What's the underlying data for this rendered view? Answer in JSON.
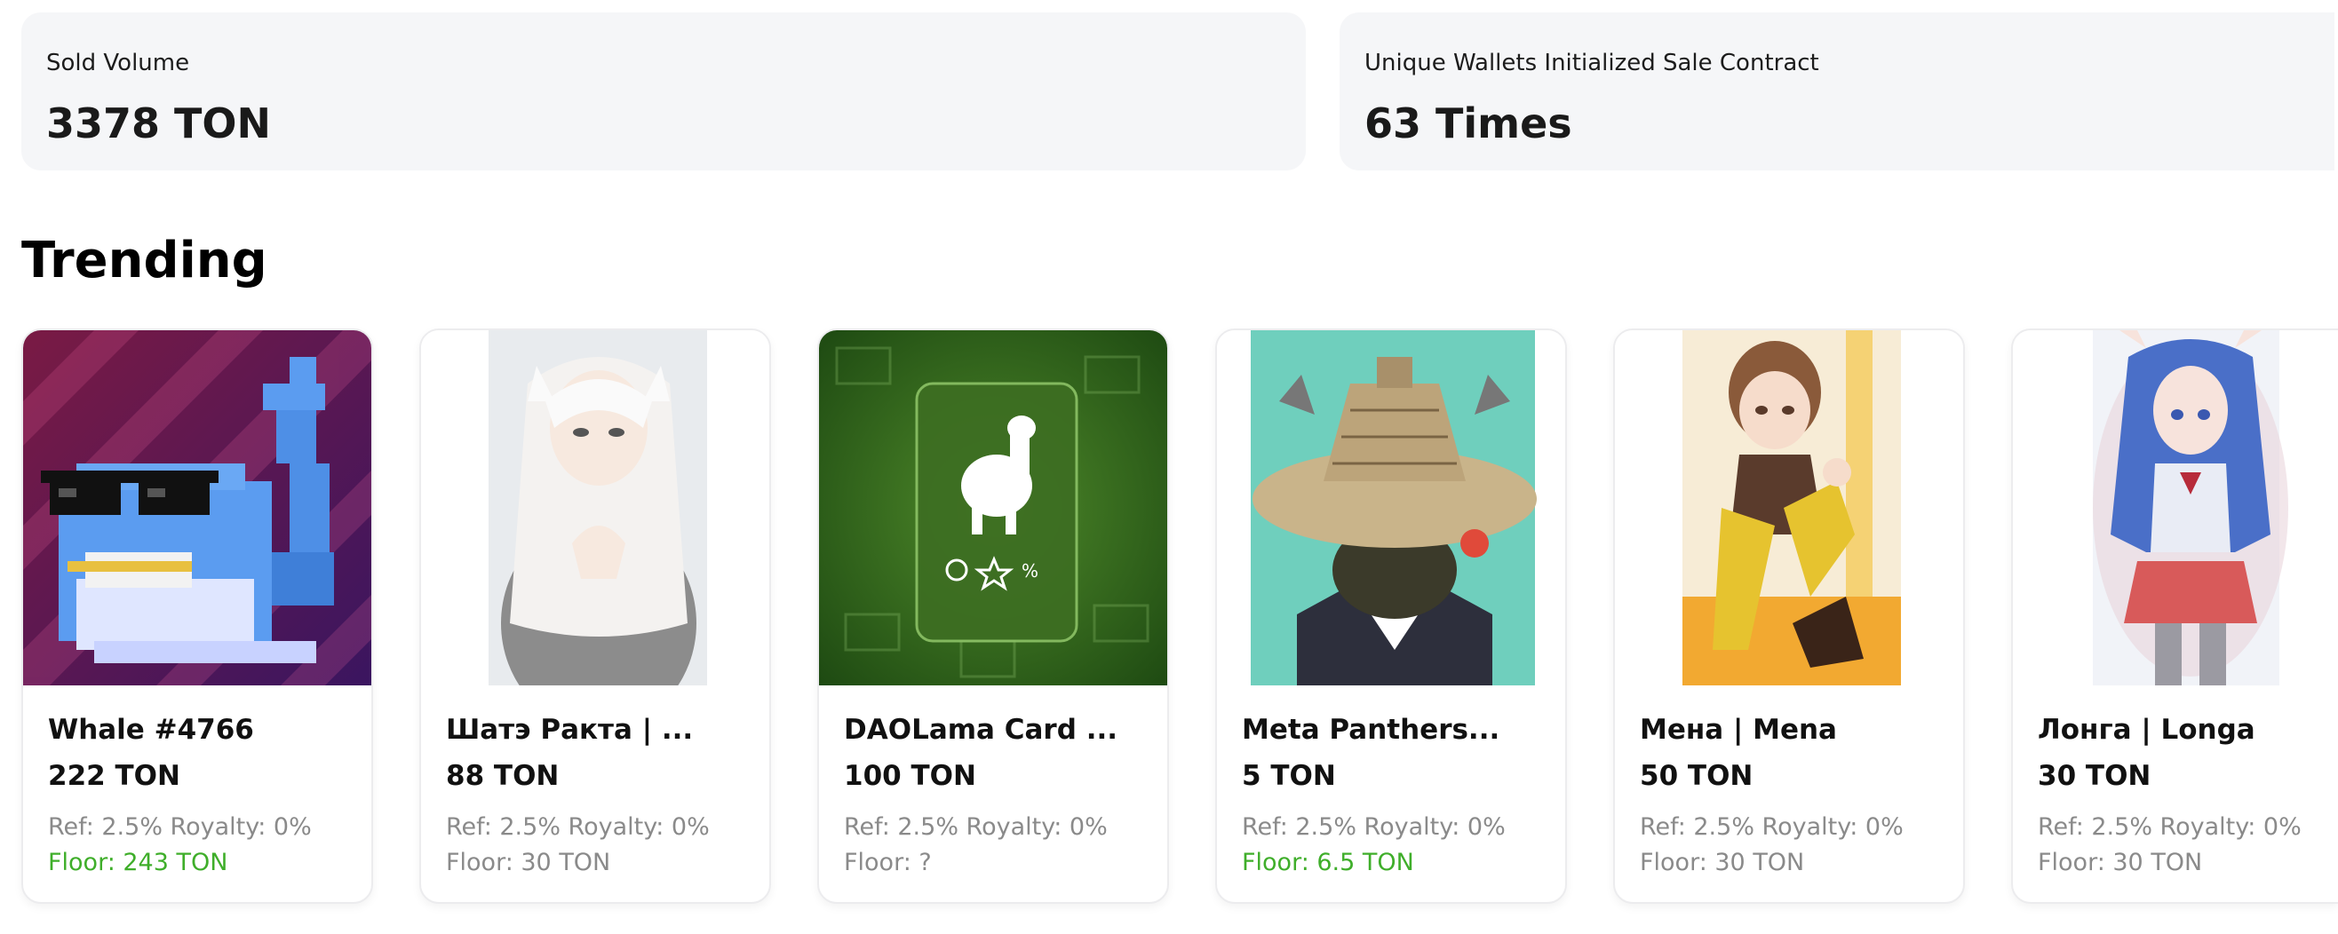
{
  "stats": {
    "sold_volume": {
      "label": "Sold Volume",
      "value": "3378 TON"
    },
    "unique_wallets": {
      "label": "Unique Wallets Initialized Sale Contract",
      "value": "63 Times"
    }
  },
  "trending": {
    "title": "Trending",
    "items": [
      {
        "name": "Whale #4766",
        "price": "222 TON",
        "fees": "Ref: 2.5% Royalty: 0%",
        "floor": "Floor: 243 TON",
        "image": "pixel-whale-with-sunglasses"
      },
      {
        "name": "Шатэ Ракта | ...",
        "price": "88 TON",
        "fees": "Ref: 2.5% Royalty: 0%",
        "floor": "Floor: 30 TON",
        "image": "anime-girl-white-hair"
      },
      {
        "name": "DAOLama Card ...",
        "price": "100 TON",
        "fees": "Ref: 2.5% Royalty: 0%",
        "floor": "Floor: ?",
        "image": "daolama-llama-card"
      },
      {
        "name": "Meta Panthers...",
        "price": "5 TON",
        "fees": "Ref: 2.5% Royalty: 0%",
        "floor": "Floor: 6.5 TON",
        "image": "panther-straw-hat"
      },
      {
        "name": "Мена | Mena",
        "price": "50 TON",
        "fees": "Ref: 2.5% Royalty: 0%",
        "floor": "Floor: 30 TON",
        "image": "anime-girl-yellow-stockings"
      },
      {
        "name": "Лонга | Longa",
        "price": "30 TON",
        "fees": "Ref: 2.5% Royalty: 0%",
        "floor": "Floor: 30 TON",
        "image": "anime-girl-blue-hair"
      }
    ]
  },
  "colors": {
    "floor_highlight": "#3fae2a",
    "muted_text": "#8a8a8a",
    "stat_bg": "#f5f6f8"
  }
}
